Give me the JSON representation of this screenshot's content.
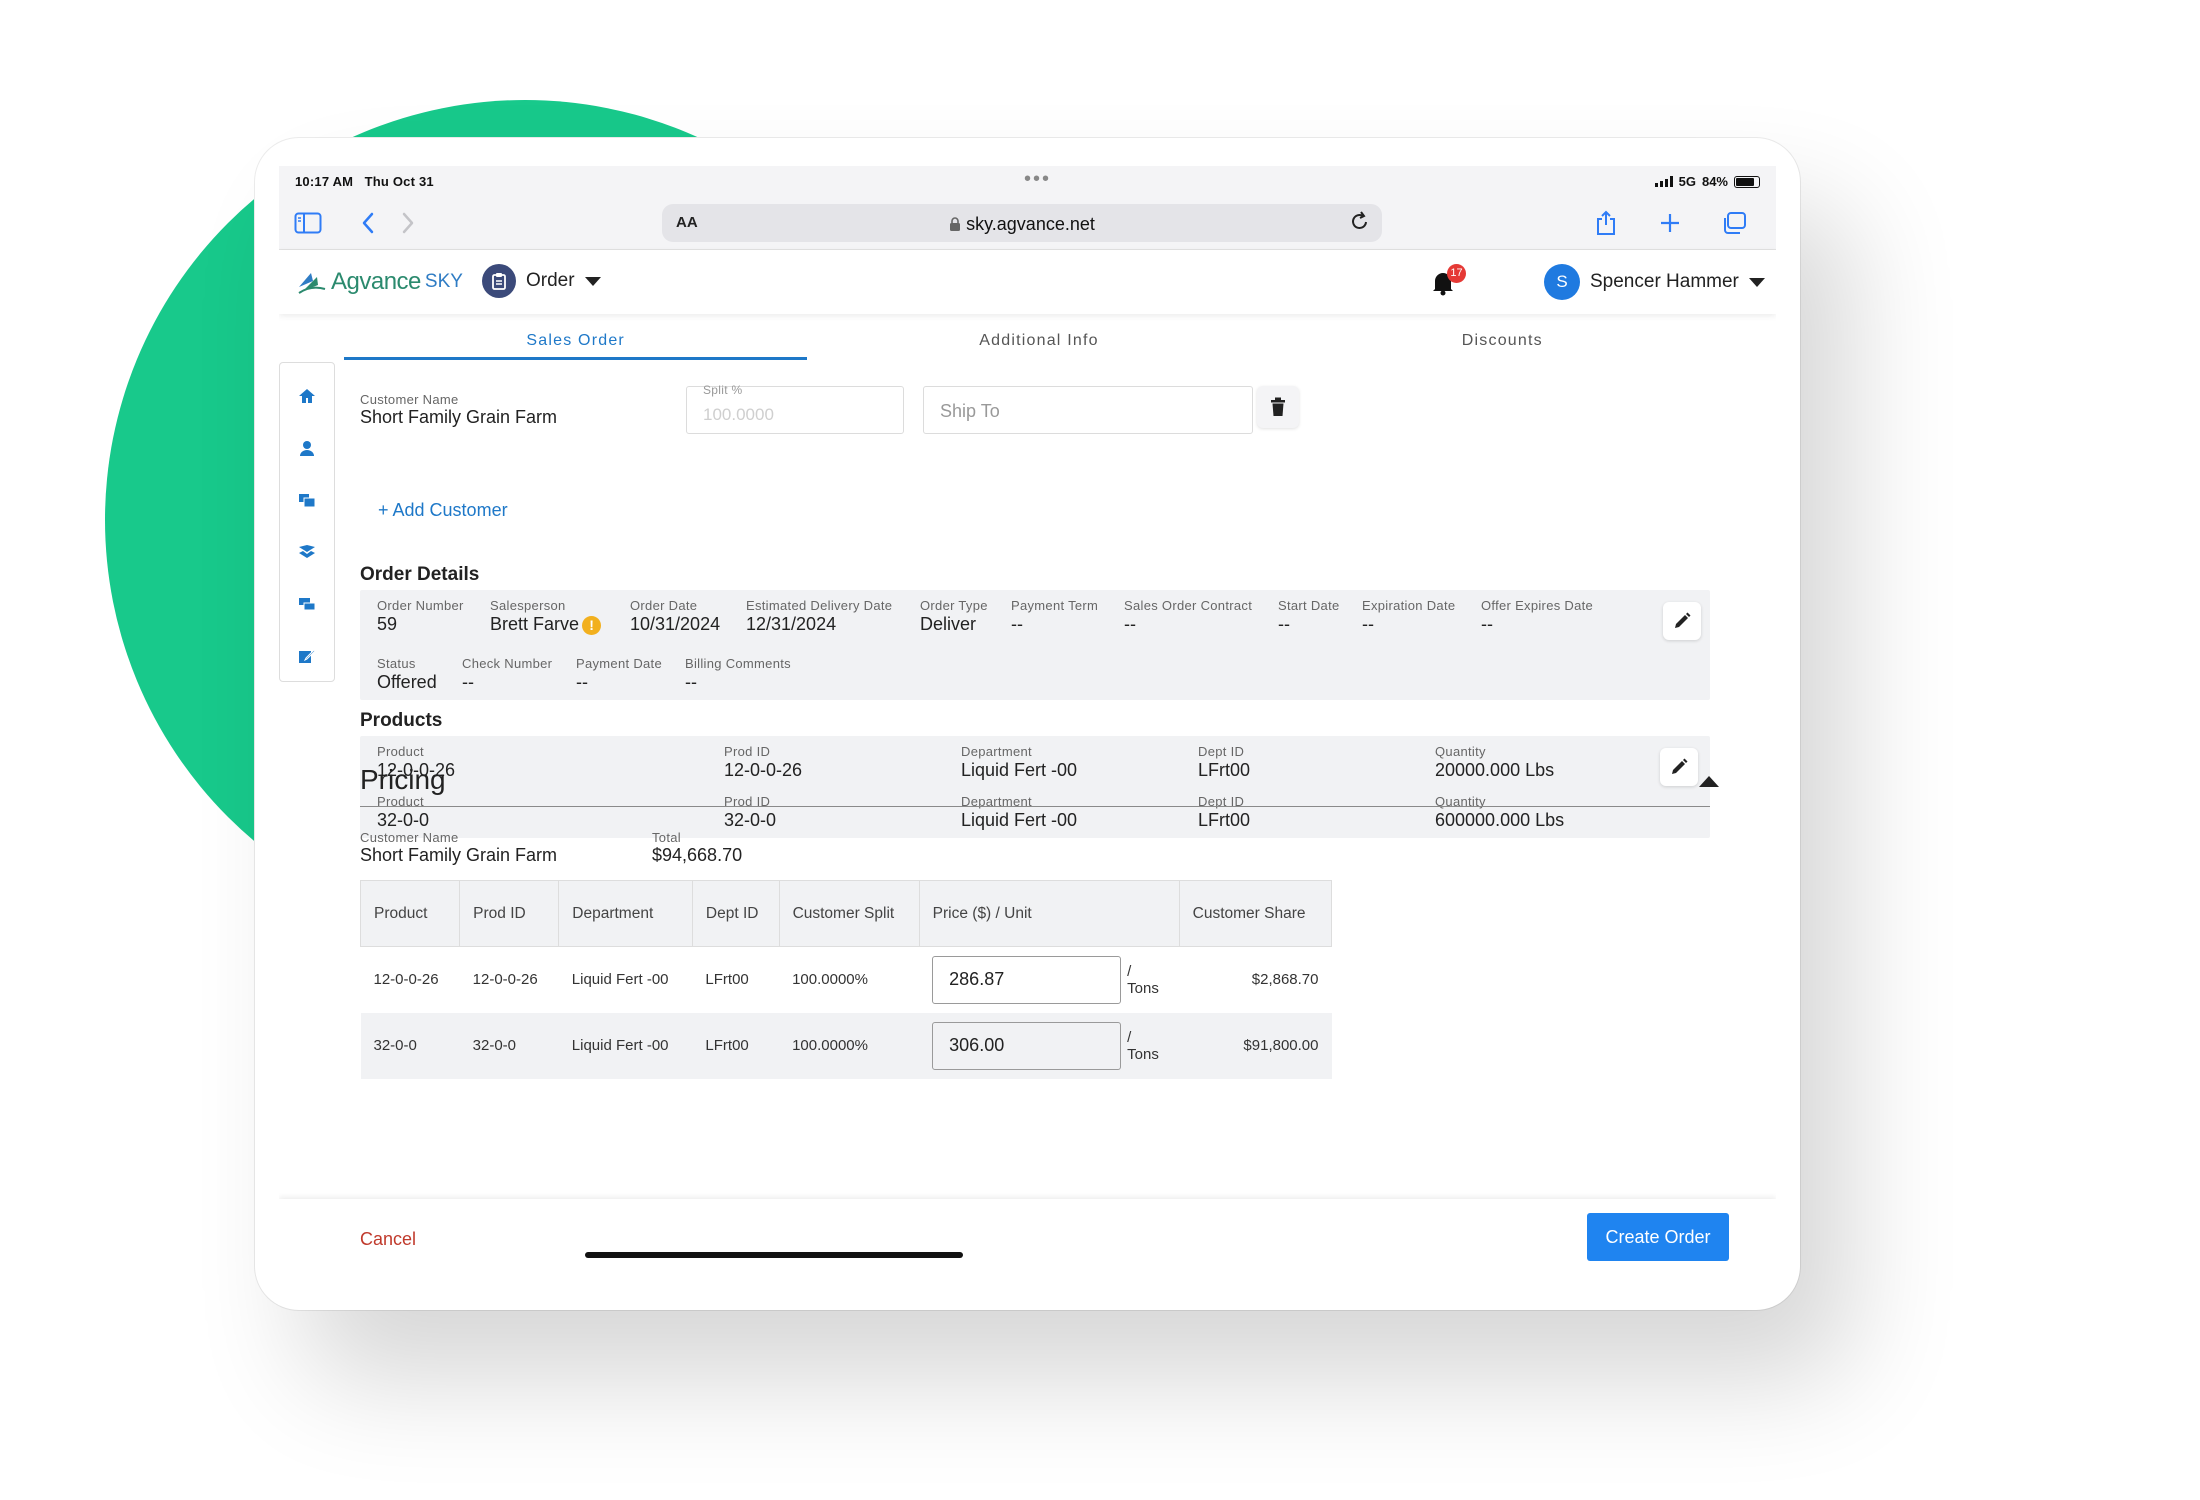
{
  "status_bar": {
    "time": "10:17 AM",
    "date": "Thu Oct 31",
    "network": "5G",
    "battery": "84%",
    "battery_level": 0.84
  },
  "browser": {
    "text_size_label": "AA",
    "url": "sky.agvance.net"
  },
  "app_header": {
    "logo_text": "Agvance",
    "logo_sub": "SKY",
    "module_label": "Order",
    "notification_count": "17",
    "user_initial": "S",
    "user_name": "Spencer Hammer"
  },
  "tabs": [
    {
      "label": "Sales Order",
      "active": true
    },
    {
      "label": "Additional Info",
      "active": false
    },
    {
      "label": "Discounts",
      "active": false
    }
  ],
  "customer": {
    "name_label": "Customer Name",
    "name_value": "Short Family Grain Farm",
    "split_label": "Split %",
    "split_placeholder": "100.0000",
    "ship_to_placeholder": "Ship To",
    "add_customer_label": "+ Add Customer"
  },
  "order_details": {
    "title": "Order Details",
    "fields": [
      {
        "label": "Order Number",
        "value": "59"
      },
      {
        "label": "Salesperson",
        "value": "Brett Farve"
      },
      {
        "label": "Order Date",
        "value": "10/31/2024"
      },
      {
        "label": "Estimated Delivery Date",
        "value": "12/31/2024"
      },
      {
        "label": "Order Type",
        "value": "Deliver"
      },
      {
        "label": "Payment Term",
        "value": "--"
      },
      {
        "label": "Sales Order Contract",
        "value": "--"
      },
      {
        "label": "Start Date",
        "value": "--"
      },
      {
        "label": "Expiration Date",
        "value": "--"
      },
      {
        "label": "Offer Expires Date",
        "value": "--"
      },
      {
        "label": "Status",
        "value": "Offered"
      },
      {
        "label": "Check Number",
        "value": "--"
      },
      {
        "label": "Payment Date",
        "value": "--"
      },
      {
        "label": "Billing Comments",
        "value": "--"
      }
    ],
    "warning_glyph": "!"
  },
  "products": {
    "title": "Products",
    "labels": {
      "product": "Product",
      "prod_id": "Prod ID",
      "department": "Department",
      "dept_id": "Dept ID",
      "quantity": "Quantity"
    },
    "rows": [
      {
        "product": "12-0-0-26",
        "prod_id": "12-0-0-26",
        "department": "Liquid Fert -00",
        "dept_id": "LFrt00",
        "quantity": "20000.000 Lbs"
      },
      {
        "product": "32-0-0",
        "prod_id": "32-0-0",
        "department": "Liquid Fert -00",
        "dept_id": "LFrt00",
        "quantity": "600000.000 Lbs"
      }
    ]
  },
  "pricing": {
    "title": "Pricing",
    "customer_name_label": "Customer Name",
    "customer_name_value": "Short Family Grain Farm",
    "total_label": "Total",
    "total_value": "$94,668.70",
    "columns": [
      "Product",
      "Prod ID",
      "Department",
      "Dept ID",
      "Customer Split",
      "Price ($) / Unit",
      "Customer Share"
    ],
    "rows": [
      {
        "product": "12-0-0-26",
        "prod_id": "12-0-0-26",
        "department": "Liquid Fert -00",
        "dept_id": "LFrt00",
        "split": "100.0000%",
        "price": "286.87",
        "unit": "/ Tons",
        "share": "$2,868.70"
      },
      {
        "product": "32-0-0",
        "prod_id": "32-0-0",
        "department": "Liquid Fert -00",
        "dept_id": "LFrt00",
        "split": "100.0000%",
        "price": "306.00",
        "unit": "/ Tons",
        "share": "$91,800.00"
      }
    ]
  },
  "footer": {
    "cancel_label": "Cancel",
    "create_label": "Create Order"
  },
  "colors": {
    "accent": "#1e78c8",
    "brand_green": "#18c98b",
    "cancel_red": "#c0392b",
    "button_blue": "#1f84f0"
  }
}
